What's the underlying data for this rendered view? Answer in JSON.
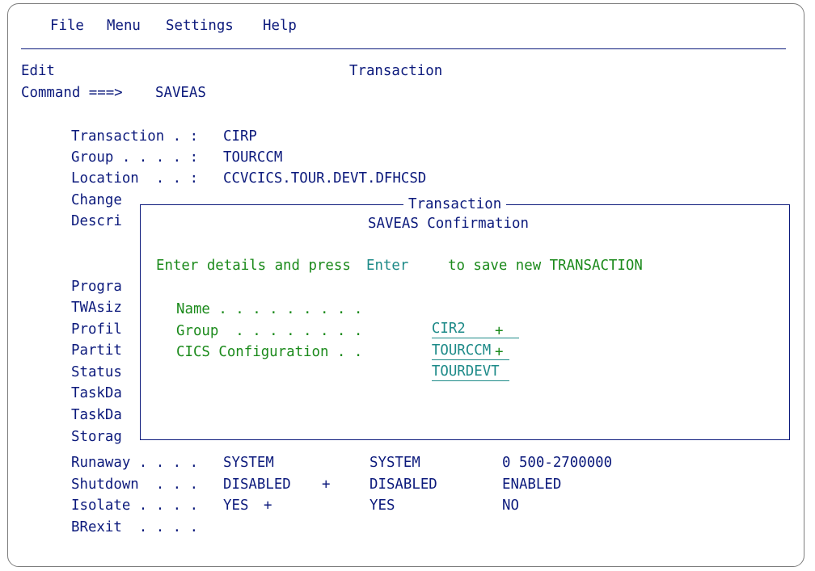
{
  "menu": {
    "items": [
      "File",
      "Menu",
      "Settings",
      "Help"
    ]
  },
  "header": {
    "mode": "Edit",
    "title": "Transaction",
    "command_label": "Command ===>",
    "command_value": "SAVEAS"
  },
  "details": {
    "transaction_label": "Transaction . :",
    "transaction_value": "CIRP",
    "group_label": "Group . . . . :",
    "group_value": "TOURCCM",
    "location_label": "Location  . . :",
    "location_value": "CCVCICS.TOUR.DEVT.DFHCSD",
    "partial_labels": [
      "Change",
      "Descri",
      "Progra",
      "TWAsiz",
      "Profil",
      "Partit",
      "Status",
      "TaskDa",
      "TaskDa",
      "Storag"
    ]
  },
  "attributes": [
    {
      "label": "Runaway . . . .",
      "value": "SYSTEM",
      "plus": "",
      "default": "SYSTEM",
      "range": "0 500-2700000"
    },
    {
      "label": "Shutdown  . . .",
      "value": "DISABLED",
      "plus": "+",
      "default": "DISABLED",
      "range": "ENABLED"
    },
    {
      "label": "Isolate . . . .",
      "value": "YES",
      "plus": "+",
      "default": "YES",
      "range": "NO"
    },
    {
      "label": "BRexit  . . . .",
      "value": "",
      "plus": "",
      "default": "",
      "range": ""
    }
  ],
  "dialog": {
    "frame_title": "Transaction",
    "heading": "SAVEAS Confirmation",
    "instruction_pre": "Enter details and press",
    "instruction_key": "Enter",
    "instruction_post": "to save new TRANSACTION",
    "name_label": "Name . . . . . . . . .",
    "name_value": "CIR2",
    "group_label": "Group  . . . . . . . .",
    "group_value": "TOURCCM",
    "group_plus": "+",
    "config_label": "CICS Configuration . .",
    "config_value": "TOURDEVT",
    "config_plus": "+"
  },
  "colors": {
    "text": "#0c1a7c",
    "prompt_green": "#1b8a1b",
    "field_teal": "#1d8a88",
    "frame_border": "#7d7d7d"
  }
}
